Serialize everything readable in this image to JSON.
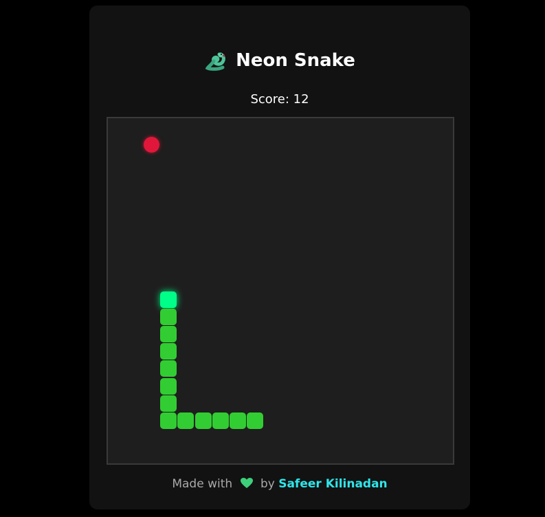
{
  "header": {
    "title": "Neon Snake",
    "icon": "snake-icon"
  },
  "score": {
    "text": "Score: 12",
    "value": 12
  },
  "board": {
    "grid_columns": 20,
    "grid_rows": 20,
    "food": {
      "col": 2,
      "row": 1,
      "color": "#e0173a"
    },
    "snake": {
      "head_color": "#00ff88",
      "body_color": "#32cd32",
      "segments": [
        {
          "col": 3,
          "row": 10
        },
        {
          "col": 3,
          "row": 11
        },
        {
          "col": 3,
          "row": 12
        },
        {
          "col": 3,
          "row": 13
        },
        {
          "col": 3,
          "row": 14
        },
        {
          "col": 3,
          "row": 15
        },
        {
          "col": 3,
          "row": 16
        },
        {
          "col": 3,
          "row": 17
        },
        {
          "col": 4,
          "row": 17
        },
        {
          "col": 5,
          "row": 17
        },
        {
          "col": 6,
          "row": 17
        },
        {
          "col": 7,
          "row": 17
        },
        {
          "col": 8,
          "row": 17
        }
      ]
    }
  },
  "footer": {
    "made_with": "Made with",
    "heart_icon": "green-heart-icon",
    "by": "by",
    "author": "Safeer Kilinadan",
    "author_color": "#2ee6ea"
  }
}
